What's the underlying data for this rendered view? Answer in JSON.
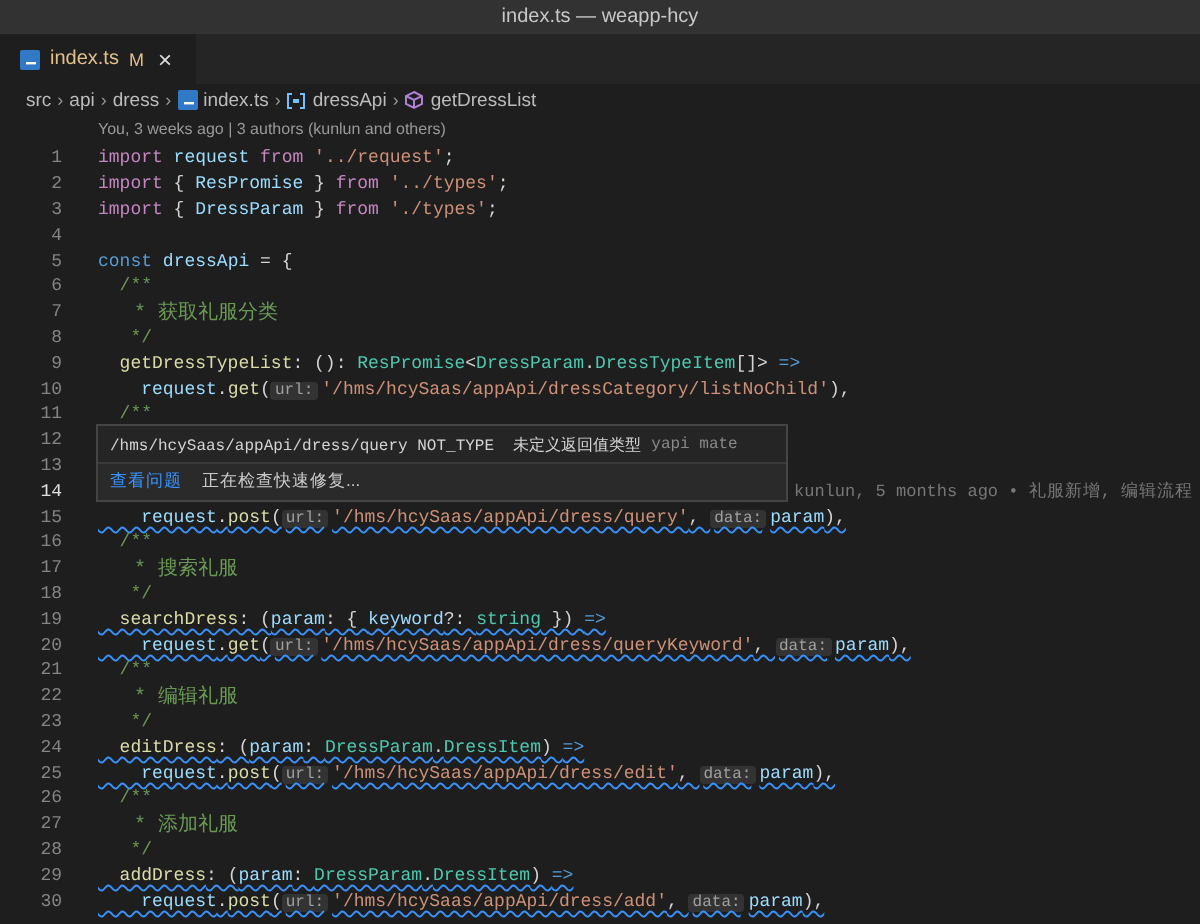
{
  "window": {
    "title": "index.ts — weapp-hcy"
  },
  "tabs": [
    {
      "label": "index.ts",
      "badge": "M",
      "selected": true,
      "close": "×"
    }
  ],
  "breadcrumb": [
    {
      "label": "src",
      "kind": "folder"
    },
    {
      "label": "api",
      "kind": "folder",
      "separator": "›"
    },
    {
      "label": "dress",
      "kind": "folder",
      "separator": "›"
    },
    {
      "label": "index.ts",
      "kind": "file",
      "separator": "›"
    },
    {
      "label": "dressApi",
      "kind": "variable",
      "separator": "›"
    },
    {
      "label": "getDressList",
      "kind": "method",
      "separator": "›"
    }
  ],
  "codelens": "You, 3 weeks ago | 3 authors (kunlun and others)",
  "lines": [
    {
      "number": "1",
      "current": false,
      "warning": false,
      "tokens": [
        {
          "kind": "kw",
          "text": "import"
        },
        {
          "kind": "var",
          "text": " request"
        },
        {
          "kind": "kw",
          "text": " from"
        },
        {
          "kind": "str",
          "text": " '../request'"
        },
        {
          "kind": "p",
          "text": ";"
        }
      ]
    },
    {
      "number": "2",
      "current": false,
      "warning": false,
      "tokens": [
        {
          "kind": "kw",
          "text": "import"
        },
        {
          "kind": "p",
          "text": " { "
        },
        {
          "kind": "var",
          "text": "ResPromise"
        },
        {
          "kind": "p",
          "text": " } "
        },
        {
          "kind": "kw",
          "text": "from"
        },
        {
          "kind": "str",
          "text": " '../types'"
        },
        {
          "kind": "p",
          "text": ";"
        }
      ]
    },
    {
      "number": "3",
      "current": false,
      "warning": false,
      "tokens": [
        {
          "kind": "kw",
          "text": "import"
        },
        {
          "kind": "p",
          "text": " { "
        },
        {
          "kind": "var",
          "text": "DressParam"
        },
        {
          "kind": "p",
          "text": " } "
        },
        {
          "kind": "kw",
          "text": "from"
        },
        {
          "kind": "str",
          "text": " './types'"
        },
        {
          "kind": "p",
          "text": ";"
        }
      ]
    },
    {
      "number": "4",
      "current": false
    },
    {
      "number": "5",
      "current": false,
      "warning": false,
      "tokens": [
        {
          "kind": "st",
          "text": "const"
        },
        {
          "kind": "var",
          "text": " dressApi"
        },
        {
          "kind": "p",
          "text": " = {"
        }
      ]
    },
    {
      "number": "6",
      "current": false,
      "warning": false,
      "tokens": [
        {
          "kind": "cmt",
          "text": "  /**"
        }
      ]
    },
    {
      "number": "7",
      "current": false,
      "warning": false,
      "tokens": [
        {
          "kind": "cmt",
          "text": "   * 获取礼服分类"
        }
      ]
    },
    {
      "number": "8",
      "current": false,
      "warning": false,
      "tokens": [
        {
          "kind": "cmt",
          "text": "   */"
        }
      ]
    },
    {
      "number": "9",
      "current": false,
      "warning": false,
      "tokens": [
        {
          "kind": "fn",
          "text": "  getDressTypeList"
        },
        {
          "kind": "p",
          "text": ": (): "
        },
        {
          "kind": "type",
          "text": "ResPromise"
        },
        {
          "kind": "p",
          "text": "<"
        },
        {
          "kind": "type",
          "text": "DressParam"
        },
        {
          "kind": "p",
          "text": "."
        },
        {
          "kind": "type",
          "text": "DressTypeItem"
        },
        {
          "kind": "p",
          "text": "[]> "
        },
        {
          "kind": "st",
          "text": "=>"
        }
      ]
    },
    {
      "number": "10",
      "current": false,
      "warning": false,
      "tokens": [
        {
          "kind": "var",
          "text": "    request"
        },
        {
          "kind": "p",
          "text": "."
        },
        {
          "kind": "fn",
          "text": "get"
        },
        {
          "kind": "p",
          "text": "("
        },
        {
          "kind": "hint",
          "text": "url:"
        },
        {
          "kind": "str",
          "text": "'/hms/hcySaas/appApi/dressCategory/listNoChild'"
        },
        {
          "kind": "p",
          "text": "),"
        }
      ]
    },
    {
      "number": "11",
      "current": false,
      "warning": false,
      "tokens": [
        {
          "kind": "cmt",
          "text": "  /**"
        }
      ]
    },
    {
      "number": "12",
      "current": false
    },
    {
      "number": "13",
      "current": false
    },
    {
      "number": "14",
      "current": true,
      "blame": "kunlun, 5 months ago • 礼服新增, 编辑流程"
    },
    {
      "number": "15",
      "current": false,
      "warning": true,
      "tokens": [
        {
          "kind": "var",
          "text": "    request"
        },
        {
          "kind": "p",
          "text": "."
        },
        {
          "kind": "fn",
          "text": "post"
        },
        {
          "kind": "p",
          "text": "("
        },
        {
          "kind": "hint",
          "text": "url:"
        },
        {
          "kind": "str",
          "text": "'/hms/hcySaas/appApi/dress/query'"
        },
        {
          "kind": "p",
          "text": ", "
        },
        {
          "kind": "hint",
          "text": "data:"
        },
        {
          "kind": "var",
          "text": "param"
        },
        {
          "kind": "p",
          "text": "),"
        }
      ]
    },
    {
      "number": "16",
      "current": false,
      "warning": false,
      "tokens": [
        {
          "kind": "cmt",
          "text": "  /**"
        }
      ]
    },
    {
      "number": "17",
      "current": false,
      "warning": false,
      "tokens": [
        {
          "kind": "cmt",
          "text": "   * 搜索礼服"
        }
      ]
    },
    {
      "number": "18",
      "current": false,
      "warning": false,
      "tokens": [
        {
          "kind": "cmt",
          "text": "   */"
        }
      ]
    },
    {
      "number": "19",
      "current": false,
      "warning": true,
      "tokens": [
        {
          "kind": "fn",
          "text": "  searchDress"
        },
        {
          "kind": "p",
          "text": ": ("
        },
        {
          "kind": "var",
          "text": "param"
        },
        {
          "kind": "p",
          "text": ": { "
        },
        {
          "kind": "var",
          "text": "keyword"
        },
        {
          "kind": "p",
          "text": "?: "
        },
        {
          "kind": "type",
          "text": "string"
        },
        {
          "kind": "p",
          "text": " }) "
        },
        {
          "kind": "st",
          "text": "=>"
        }
      ]
    },
    {
      "number": "20",
      "current": false,
      "warning": true,
      "tokens": [
        {
          "kind": "var",
          "text": "    request"
        },
        {
          "kind": "p",
          "text": "."
        },
        {
          "kind": "fn",
          "text": "get"
        },
        {
          "kind": "p",
          "text": "("
        },
        {
          "kind": "hint",
          "text": "url:"
        },
        {
          "kind": "str",
          "text": "'/hms/hcySaas/appApi/dress/queryKeyword'"
        },
        {
          "kind": "p",
          "text": ", "
        },
        {
          "kind": "hint",
          "text": "data:"
        },
        {
          "kind": "var",
          "text": "param"
        },
        {
          "kind": "p",
          "text": "),"
        }
      ]
    },
    {
      "number": "21",
      "current": false,
      "warning": false,
      "tokens": [
        {
          "kind": "cmt",
          "text": "  /**"
        }
      ]
    },
    {
      "number": "22",
      "current": false,
      "warning": false,
      "tokens": [
        {
          "kind": "cmt",
          "text": "   * 编辑礼服"
        }
      ]
    },
    {
      "number": "23",
      "current": false,
      "warning": false,
      "tokens": [
        {
          "kind": "cmt",
          "text": "   */"
        }
      ]
    },
    {
      "number": "24",
      "current": false,
      "warning": true,
      "tokens": [
        {
          "kind": "fn",
          "text": "  editDress"
        },
        {
          "kind": "p",
          "text": ": ("
        },
        {
          "kind": "var",
          "text": "param"
        },
        {
          "kind": "p",
          "text": ": "
        },
        {
          "kind": "type",
          "text": "DressParam"
        },
        {
          "kind": "p",
          "text": "."
        },
        {
          "kind": "type",
          "text": "DressItem"
        },
        {
          "kind": "p",
          "text": ") "
        },
        {
          "kind": "st",
          "text": "=>"
        }
      ]
    },
    {
      "number": "25",
      "current": false,
      "warning": true,
      "tokens": [
        {
          "kind": "var",
          "text": "    request"
        },
        {
          "kind": "p",
          "text": "."
        },
        {
          "kind": "fn",
          "text": "post"
        },
        {
          "kind": "p",
          "text": "("
        },
        {
          "kind": "hint",
          "text": "url:"
        },
        {
          "kind": "str",
          "text": "'/hms/hcySaas/appApi/dress/edit'"
        },
        {
          "kind": "p",
          "text": ", "
        },
        {
          "kind": "hint",
          "text": "data:"
        },
        {
          "kind": "var",
          "text": "param"
        },
        {
          "kind": "p",
          "text": "),"
        }
      ]
    },
    {
      "number": "26",
      "current": false,
      "warning": false,
      "tokens": [
        {
          "kind": "cmt",
          "text": "  /**"
        }
      ]
    },
    {
      "number": "27",
      "current": false,
      "warning": false,
      "tokens": [
        {
          "kind": "cmt",
          "text": "   * 添加礼服"
        }
      ]
    },
    {
      "number": "28",
      "current": false,
      "warning": false,
      "tokens": [
        {
          "kind": "cmt",
          "text": "   */"
        }
      ]
    },
    {
      "number": "29",
      "current": false,
      "warning": true,
      "tokens": [
        {
          "kind": "fn",
          "text": "  addDress"
        },
        {
          "kind": "p",
          "text": ": ("
        },
        {
          "kind": "var",
          "text": "param"
        },
        {
          "kind": "p",
          "text": ": "
        },
        {
          "kind": "type",
          "text": "DressParam"
        },
        {
          "kind": "p",
          "text": "."
        },
        {
          "kind": "type",
          "text": "DressItem"
        },
        {
          "kind": "p",
          "text": ") "
        },
        {
          "kind": "st",
          "text": "=>"
        }
      ]
    },
    {
      "number": "30",
      "current": false,
      "warning": true,
      "tokens": [
        {
          "kind": "var",
          "text": "    request"
        },
        {
          "kind": "p",
          "text": "."
        },
        {
          "kind": "fn",
          "text": "post"
        },
        {
          "kind": "p",
          "text": "("
        },
        {
          "kind": "hint",
          "text": "url:"
        },
        {
          "kind": "str",
          "text": "'/hms/hcySaas/appApi/dress/add'"
        },
        {
          "kind": "p",
          "text": ", "
        },
        {
          "kind": "hint",
          "text": "data:"
        },
        {
          "kind": "var",
          "text": "param"
        },
        {
          "kind": "p",
          "text": "),"
        }
      ]
    }
  ],
  "hover": {
    "message": "/hms/hcySaas/appApi/dress/query NOT_TYPE  未定义返回值类型",
    "source": "yapi mate",
    "actions": [
      {
        "label": "查看问题",
        "kind": "link"
      },
      {
        "label": "正在检查快速修复...",
        "kind": "status"
      }
    ]
  }
}
